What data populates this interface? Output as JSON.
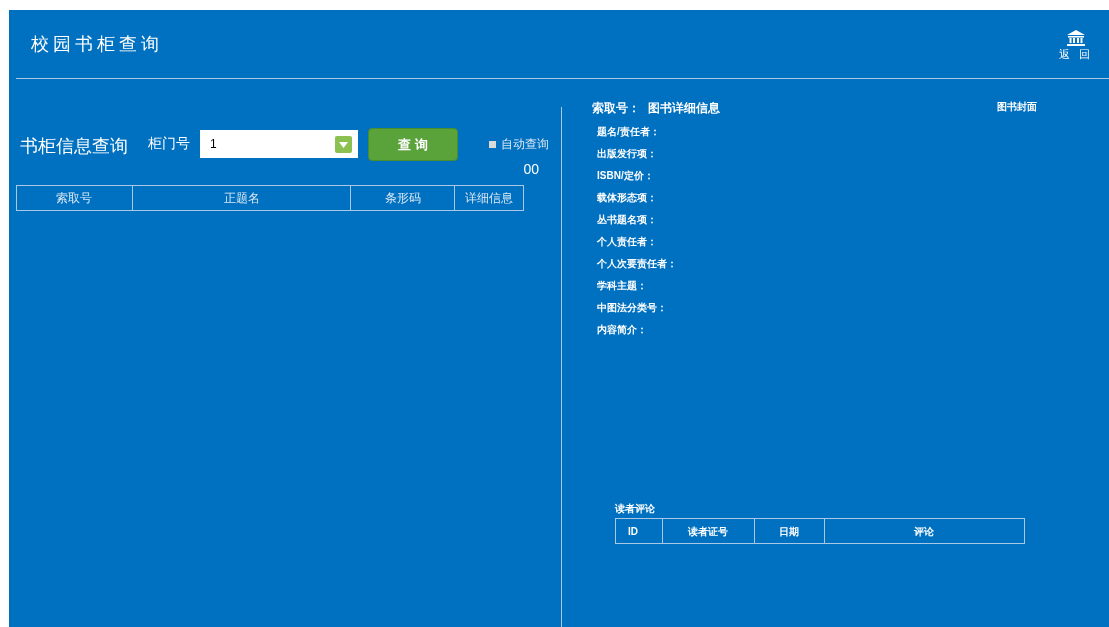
{
  "header": {
    "title": "校园书柜查询",
    "back_label": "返 回"
  },
  "query": {
    "title": "书柜信息查询",
    "door_label": "柜门号",
    "door_value": "1",
    "query_button": "查 询",
    "auto_query": {
      "label": "自动查询",
      "checked": false
    },
    "count": "00"
  },
  "table": {
    "columns": [
      "索取号",
      "正题名",
      "条形码",
      "详细信息"
    ]
  },
  "detail": {
    "call_number_label": "索取号：",
    "title": "图书详细信息",
    "cover_label": "图书封面",
    "fields": [
      "题名/责任者：",
      "出版发行项：",
      "ISBN/定价：",
      "载体形态项：",
      "丛书题名项：",
      "个人责任者：",
      "个人次要责任者：",
      "学科主题：",
      "中图法分类号：",
      "内容简介："
    ]
  },
  "comments": {
    "title": "读者评论",
    "columns": [
      "ID",
      "读者证号",
      "日期",
      "评论"
    ]
  }
}
